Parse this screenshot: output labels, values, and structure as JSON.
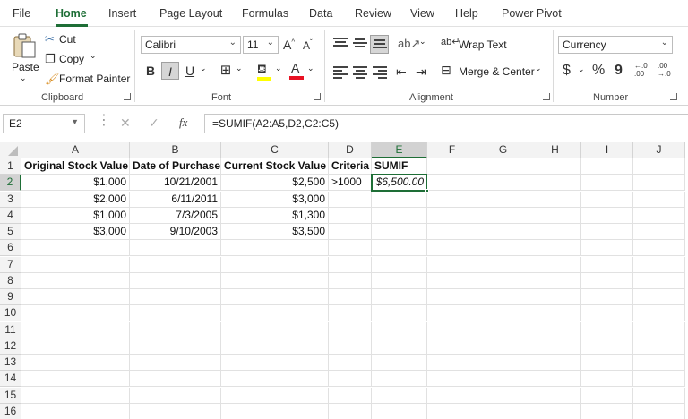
{
  "tabs": [
    "File",
    "Home",
    "Insert",
    "Page Layout",
    "Formulas",
    "Data",
    "Review",
    "View",
    "Help",
    "Power Pivot"
  ],
  "clipboard": {
    "paste": "Paste",
    "cut": "Cut",
    "copy": "Copy",
    "format_painter": "Format Painter",
    "label": "Clipboard"
  },
  "font": {
    "name": "Calibri",
    "size": "11",
    "label": "Font",
    "bold": "B",
    "italic": "I",
    "underline": "U",
    "font_color": "A",
    "font_color_hex": "#e81123",
    "highlight_hex": "#ffff00"
  },
  "alignment": {
    "wrap_text": "Wrap Text",
    "merge_center": "Merge & Center",
    "label": "Alignment"
  },
  "number": {
    "format": "Currency",
    "dollar": "$",
    "percent": "%",
    "comma": "9",
    "label": "Number",
    "inc_decimal": "←.0\n.00",
    "dec_decimal": ".00\n→.0"
  },
  "formula_bar": {
    "name_box": "E2",
    "fx": "fx",
    "formula": "=SUMIF(A2:A5,D2,C2:C5)"
  },
  "columns": [
    "A",
    "B",
    "C",
    "D",
    "E",
    "F",
    "G",
    "H",
    "I",
    "J"
  ],
  "rows": [
    "1",
    "2",
    "3",
    "4",
    "5",
    "6",
    "7",
    "8",
    "9",
    "10",
    "11",
    "12",
    "13",
    "14",
    "15",
    "16"
  ],
  "cells": {
    "A1": "Original Stock Value",
    "B1": "Date of Purchase",
    "C1": "Current Stock Value",
    "D1": "Criteria",
    "E1": "SUMIF",
    "A2": "$1,000",
    "B2": "10/21/2001",
    "C2": "$2,500",
    "D2": ">1000",
    "E2": "$6,500.00",
    "A3": "$2,000",
    "B3": "6/11/2011",
    "C3": "$3,000",
    "A4": "$1,000",
    "B4": "7/3/2005",
    "C4": "$1,300",
    "A5": "$3,000",
    "B5": "9/10/2003",
    "C5": "$3,500"
  },
  "selected_cell": "E2",
  "accent_hex": "#1e6e36"
}
